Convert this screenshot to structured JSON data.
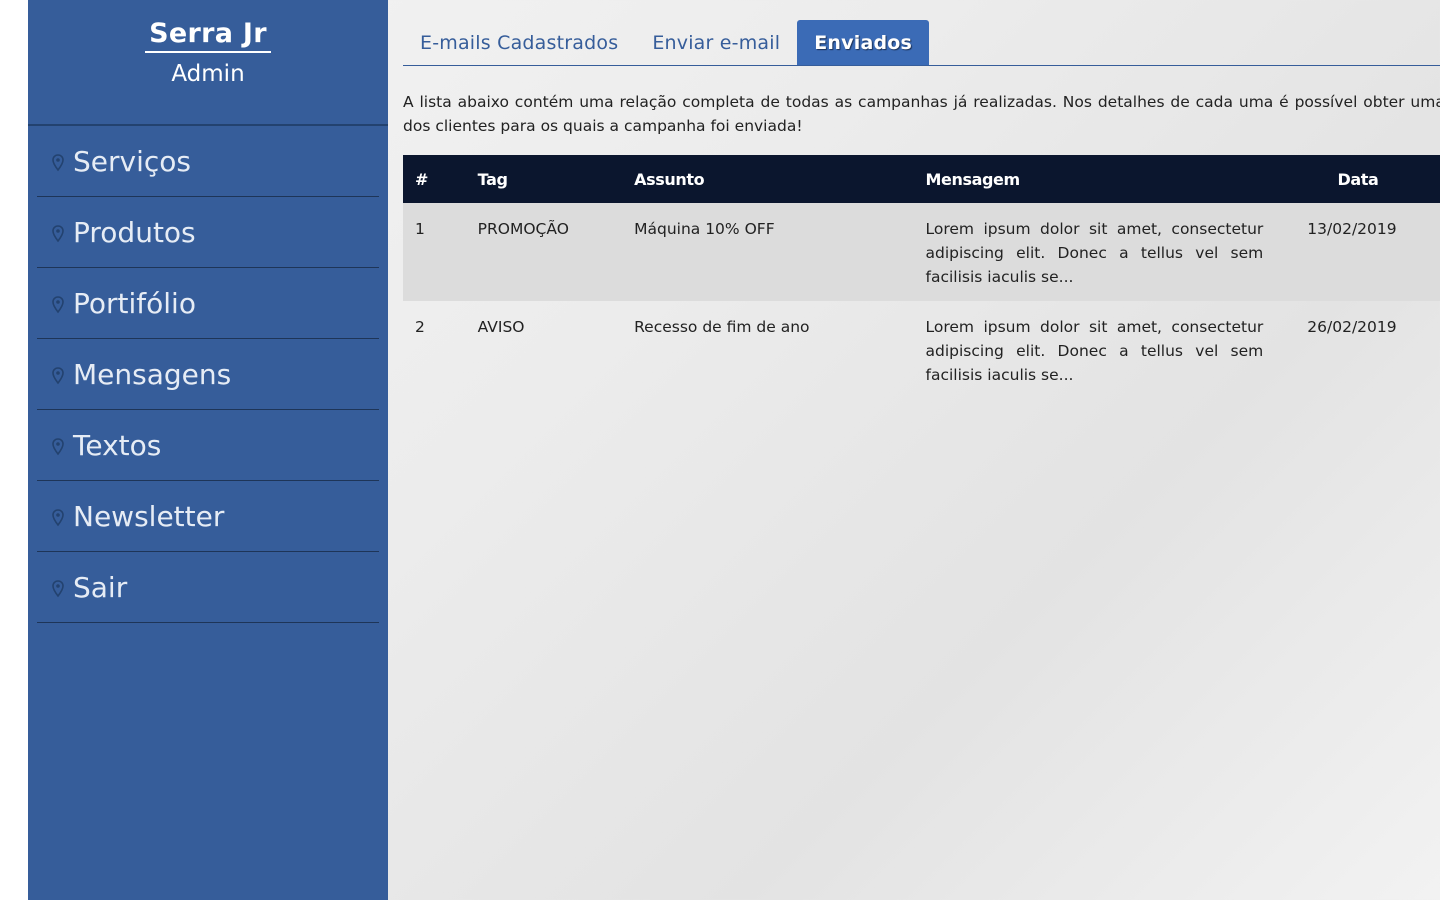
{
  "sidebar": {
    "brand": "Serra Jr",
    "role": "Admin",
    "items": [
      {
        "label": "Serviços"
      },
      {
        "label": "Produtos"
      },
      {
        "label": "Portifólio"
      },
      {
        "label": "Mensagens"
      },
      {
        "label": "Textos"
      },
      {
        "label": "Newsletter"
      },
      {
        "label": "Sair"
      }
    ],
    "item_icon": "map-pin-icon"
  },
  "tabs": [
    {
      "label": "E-mails Cadastrados",
      "active": false
    },
    {
      "label": "Enviar e-mail",
      "active": false
    },
    {
      "label": "Enviados",
      "active": true
    }
  ],
  "intro_text": "A lista abaixo contém uma relação completa de todas as campanhas já realizadas. Nos detalhes de cada uma é possível obter uma lista dos clientes para os quais a campanha foi enviada!",
  "table": {
    "headers": [
      "#",
      "Tag",
      "Assunto",
      "Mensagem",
      "Data"
    ],
    "rows": [
      {
        "id": "1",
        "tag": "PROMOÇÃO",
        "subject": "Máquina 10% OFF",
        "message": "Lorem ipsum dolor sit amet, consectetur adipiscing elit. Donec a tellus vel sem facilisis iaculis se...",
        "date": "13/02/2019"
      },
      {
        "id": "2",
        "tag": "AVISO",
        "subject": "Recesso de fim de ano",
        "message": "Lorem ipsum dolor sit amet, consectetur adipiscing elit. Donec a tellus vel sem facilisis iaculis se...",
        "date": "26/02/2019"
      }
    ]
  },
  "colors": {
    "sidebar_bg": "#365d9a",
    "tab_active_bg": "#3b6bb6",
    "table_header_bg": "#0b162e",
    "row_alt_bg": "#dcdcdc"
  }
}
